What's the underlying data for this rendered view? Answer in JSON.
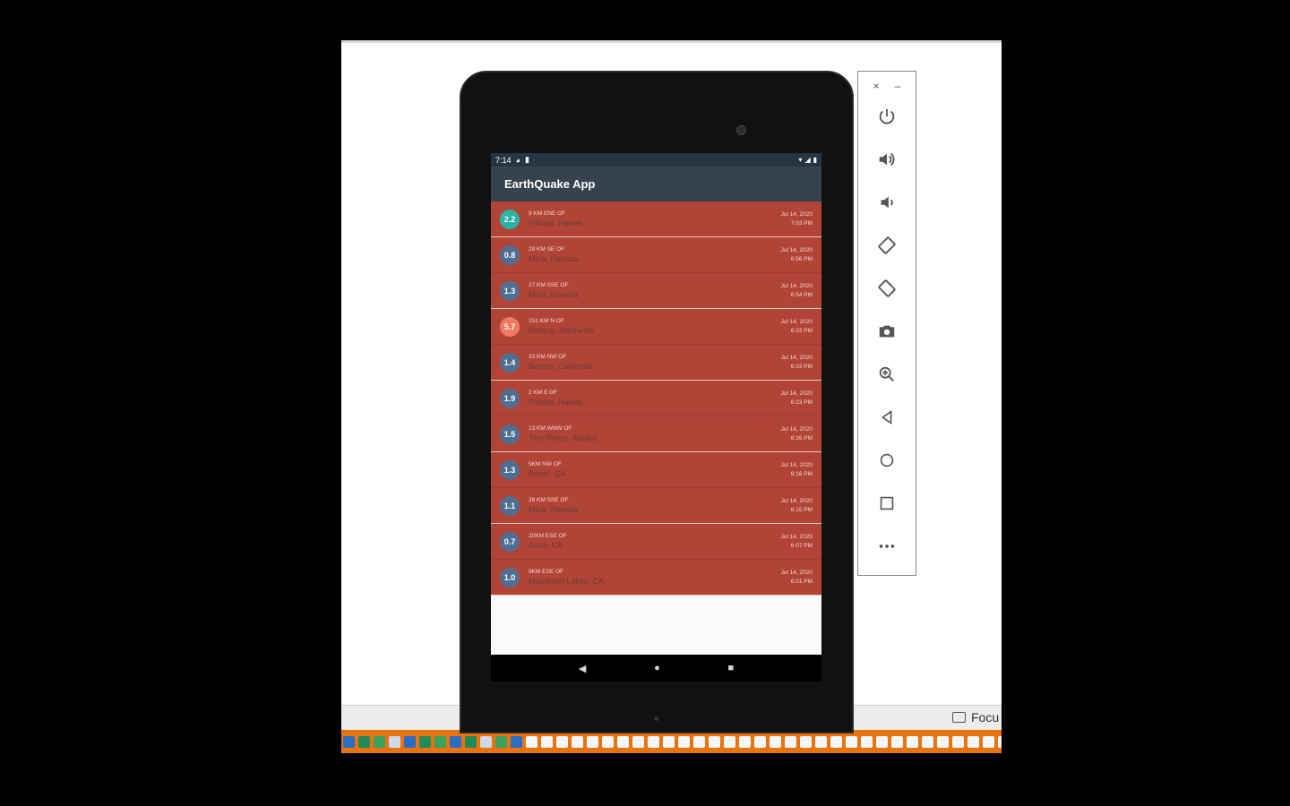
{
  "window_controls": {
    "close": "×",
    "minimize": "–"
  },
  "emulator_buttons": [
    {
      "name": "power-icon"
    },
    {
      "name": "volume-up-icon"
    },
    {
      "name": "volume-down-icon"
    },
    {
      "name": "rotate-left-icon"
    },
    {
      "name": "rotate-right-icon"
    },
    {
      "name": "camera-icon"
    },
    {
      "name": "zoom-icon"
    },
    {
      "name": "back-icon"
    },
    {
      "name": "home-icon"
    },
    {
      "name": "overview-icon"
    },
    {
      "name": "more-icon"
    }
  ],
  "status_bar": {
    "time": "7:14"
  },
  "app": {
    "title": "EarthQuake App"
  },
  "earthquakes": [
    {
      "mag": "2.2",
      "color": "#2db3a6",
      "offset": "9 KM ENE OF",
      "place": "Pāhala, Hawaii",
      "date": "Jul 14, 2020",
      "time": "7:03 PM"
    },
    {
      "mag": "0.8",
      "color": "#4f6f92",
      "offset": "29 KM SE OF",
      "place": "Mina, Nevada",
      "date": "Jul 14, 2020",
      "time": "6:56 PM"
    },
    {
      "mag": "1.3",
      "color": "#4f6f92",
      "offset": "27 KM SSE OF",
      "place": "Mina, Nevada",
      "date": "Jul 14, 2020",
      "time": "6:54 PM"
    },
    {
      "mag": "5.7",
      "color": "#f1795f",
      "offset": "151 KM N OF",
      "place": "Ruteng, Indonesia",
      "date": "Jul 14, 2020",
      "time": "6:33 PM"
    },
    {
      "mag": "1.4",
      "color": "#4f6f92",
      "offset": "33 KM NW OF",
      "place": "Benton, California",
      "date": "Jul 14, 2020",
      "time": "6:33 PM"
    },
    {
      "mag": "1.9",
      "color": "#4f6f92",
      "offset": "2 KM E OF",
      "place": "Pāhala, Hawaii",
      "date": "Jul 14, 2020",
      "time": "6:23 PM"
    },
    {
      "mag": "1.5",
      "color": "#4f6f92",
      "offset": "13 KM WNW OF",
      "place": "Two Rivers, Alaska",
      "date": "Jul 14, 2020",
      "time": "6:16 PM"
    },
    {
      "mag": "1.3",
      "color": "#4f6f92",
      "offset": "5KM NW OF",
      "place": "Boron, CA",
      "date": "Jul 14, 2020",
      "time": "6:16 PM"
    },
    {
      "mag": "1.1",
      "color": "#4f6f92",
      "offset": "28 KM SSE OF",
      "place": "Mina, Nevada",
      "date": "Jul 14, 2020",
      "time": "6:15 PM"
    },
    {
      "mag": "0.7",
      "color": "#4f6f92",
      "offset": "20KM ESE OF",
      "place": "Anza, CA",
      "date": "Jul 14, 2020",
      "time": "6:07 PM"
    },
    {
      "mag": "1.0",
      "color": "#4f6f92",
      "offset": "9KM ESE OF",
      "place": "Mammoth Lakes, CA",
      "date": "Jul 14, 2020",
      "time": "6:01 PM"
    }
  ],
  "nav": {
    "back": "◀",
    "home": "●",
    "recents": "■"
  },
  "desktop": {
    "focus_label": "Focu"
  }
}
